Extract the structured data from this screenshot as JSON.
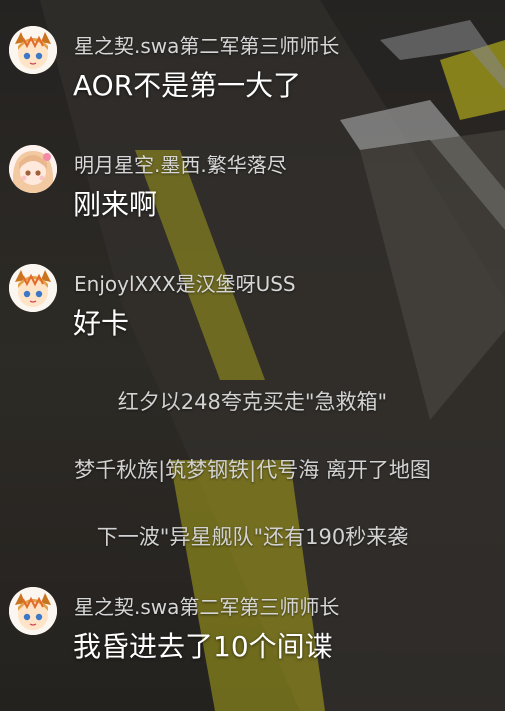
{
  "messages": [
    {
      "username": "星之契.swa第二军第三师师长",
      "text": "AOR不是第一大了",
      "avatar": "horned-avatar-icon"
    },
    {
      "username": "明月星空.墨西.繁华落尽",
      "text": "刚来啊",
      "avatar": "girl-avatar-icon"
    },
    {
      "username": "EnjoylXXX是汉堡呀USS",
      "text": "好卡",
      "avatar": "horned-avatar-icon"
    },
    {
      "username": "星之契.swa第二军第三师师长",
      "text": "我昏进去了10个间谍",
      "avatar": "horned-avatar-icon"
    }
  ],
  "system_notices": [
    "红夕以248夸克买走\"急救箱\"",
    "梦千秋族|筑梦钢铁|代号海 离开了地图",
    "下一波\"异星舰队\"还有190秒来袭"
  ],
  "colors": {
    "username": "#d7d7d7",
    "message_text": "#ffffff",
    "system_text": "#d2d2d2",
    "road_stripe": "#c8c01c",
    "background": "#2e2b27"
  }
}
